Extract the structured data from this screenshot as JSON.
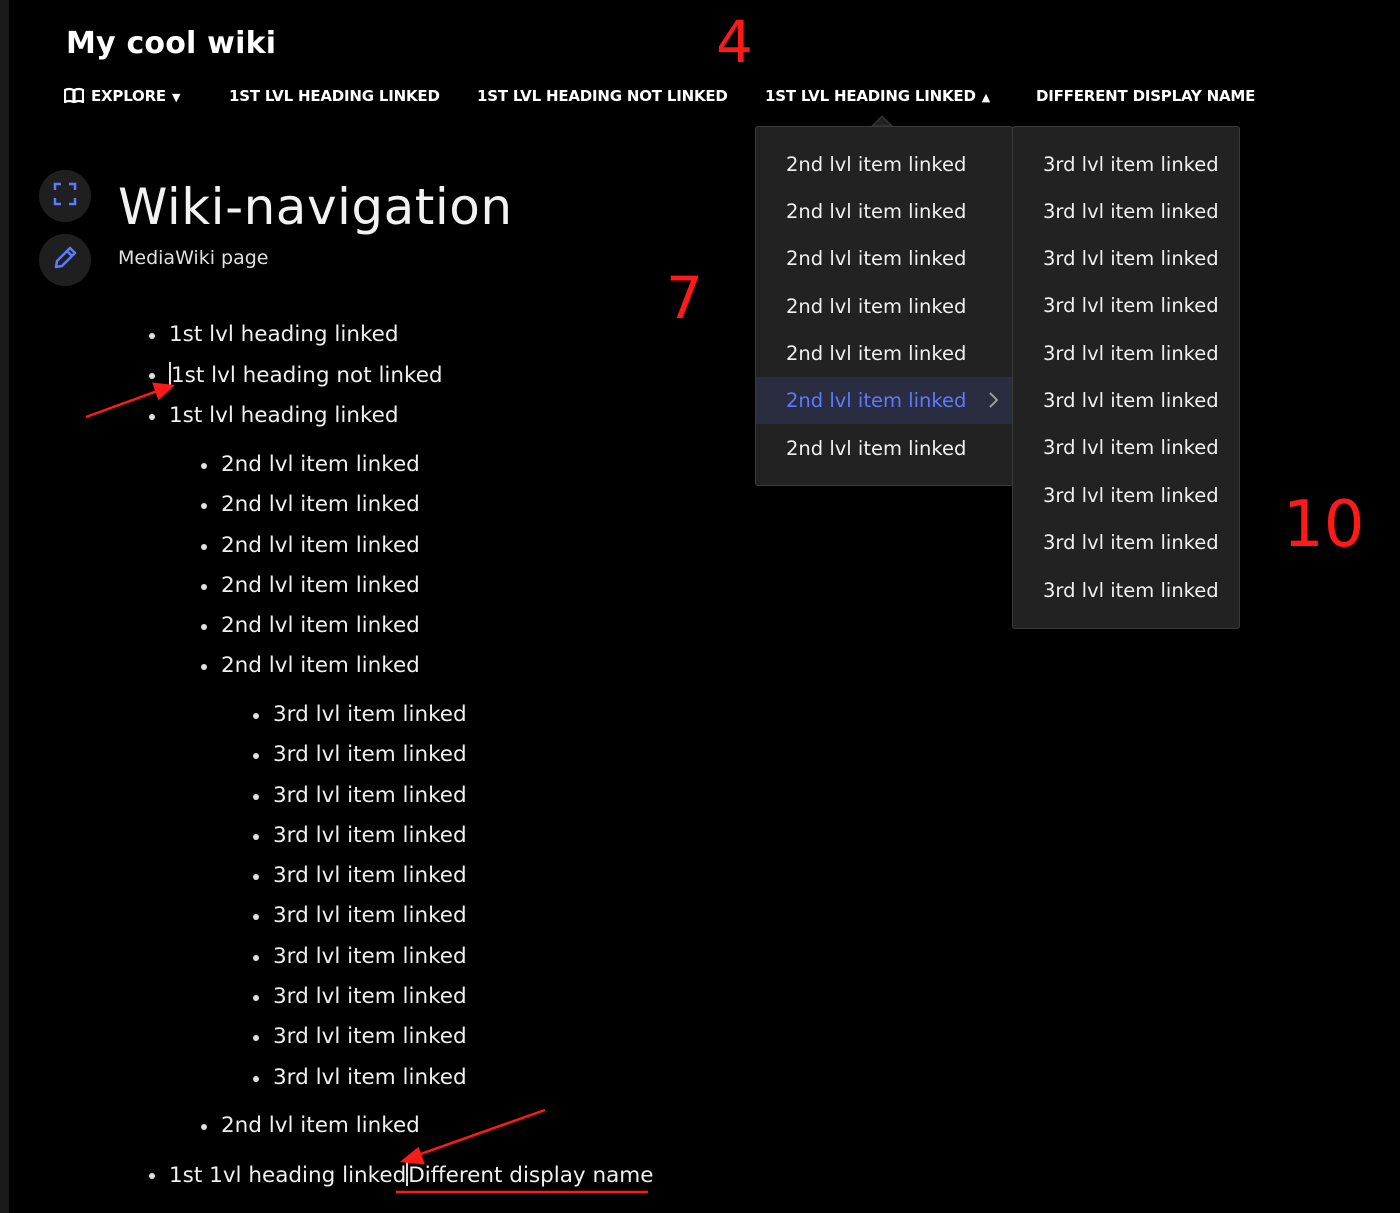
{
  "header": {
    "wiki_title": "My cool wiki",
    "nav": [
      {
        "label": "EXPLORE",
        "icon": "book-icon",
        "caret": "▼"
      },
      {
        "label": "1ST LVL HEADING LINKED"
      },
      {
        "label": "1ST LVL HEADING NOT LINKED"
      },
      {
        "label": "1ST LVL HEADING LINKED",
        "caret": "▲"
      },
      {
        "label": "DIFFERENT DISPLAY NAME"
      }
    ]
  },
  "annotations": {
    "num_4": "4",
    "num_7": "7",
    "num_10": "10"
  },
  "tools": {
    "fullscreen_icon": "expand-icon",
    "edit_icon": "pencil-icon"
  },
  "page": {
    "title": "Wiki-navigation",
    "subtitle": "MediaWiki page"
  },
  "content": {
    "level1": [
      "1st lvl heading linked",
      "1st lvl heading not linked",
      "1st lvl heading linked",
      "1st 1vl heading linked",
      "Different display name"
    ],
    "level2": [
      "2nd lvl item linked",
      "2nd lvl item linked",
      "2nd lvl item linked",
      "2nd lvl item linked",
      "2nd lvl item linked",
      "2nd lvl item linked",
      "2nd lvl item linked"
    ],
    "level3": [
      "3rd lvl item linked",
      "3rd lvl item linked",
      "3rd lvl item linked",
      "3rd lvl item linked",
      "3rd lvl item linked",
      "3rd lvl item linked",
      "3rd lvl item linked",
      "3rd lvl item linked",
      "3rd lvl item linked",
      "3rd lvl item linked"
    ]
  },
  "dropdown": {
    "level2": [
      "2nd lvl item linked",
      "2nd lvl item linked",
      "2nd lvl item linked",
      "2nd lvl item linked",
      "2nd lvl item linked",
      "2nd lvl item linked",
      "2nd lvl item linked"
    ],
    "active_index": 5,
    "level3": [
      "3rd lvl item linked",
      "3rd lvl item linked",
      "3rd lvl item linked",
      "3rd lvl item linked",
      "3rd lvl item linked",
      "3rd lvl item linked",
      "3rd lvl item linked",
      "3rd lvl item linked",
      "3rd lvl item linked",
      "3rd lvl item linked"
    ]
  },
  "colors": {
    "accent": "#5d79ff",
    "annotation": "#ff1a1a",
    "background": "#000000",
    "menu": "#222222"
  }
}
